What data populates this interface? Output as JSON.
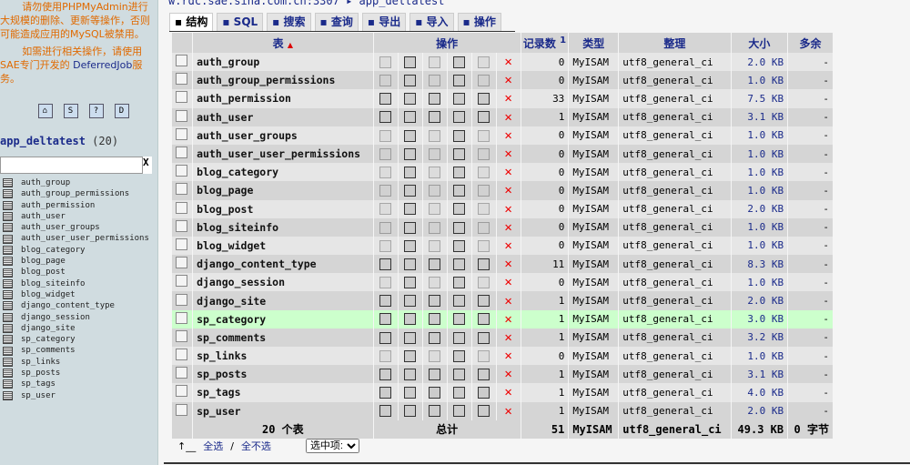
{
  "sidebar": {
    "warning1": "请勿使用PHPMyAdmin进行大规模的删除、更新等操作，否则可能造成应用的MySQL被禁用。",
    "warning2_prefix": "如需进行相关操作，请使用SAE专门开发的 ",
    "warning2_link": "DeferredJob",
    "warning2_suffix": "服务。",
    "db_name": "app_deltatest",
    "db_count": "(20)",
    "filter_clear": "X",
    "icons": [
      "home-icon",
      "sql-icon",
      "help-icon",
      "docs-icon"
    ]
  },
  "breadcrumb": {
    "server": "w.rdc.sae.sina.com.cn:3307",
    "sep": "▸",
    "db": "app_deltatest"
  },
  "tabs": [
    {
      "label": "结构",
      "icon": "structure-icon",
      "active": true
    },
    {
      "label": "SQL",
      "icon": "sql-icon"
    },
    {
      "label": "搜索",
      "icon": "search-icon"
    },
    {
      "label": "查询",
      "icon": "query-icon"
    },
    {
      "label": "导出",
      "icon": "export-icon"
    },
    {
      "label": "导入",
      "icon": "import-icon"
    },
    {
      "label": "操作",
      "icon": "operations-icon"
    }
  ],
  "columns": {
    "table": "表",
    "sort": "▲",
    "ops": "操作",
    "records": "记录数",
    "records_note": "1",
    "type": "类型",
    "collation": "整理",
    "size": "大小",
    "overhead": "多余"
  },
  "rows": [
    {
      "name": "auth_group",
      "records": "0",
      "type": "MyISAM",
      "collation": "utf8_general_ci",
      "size": "2.0 KB",
      "overhead": "-"
    },
    {
      "name": "auth_group_permissions",
      "records": "0",
      "type": "MyISAM",
      "collation": "utf8_general_ci",
      "size": "1.0 KB",
      "overhead": "-"
    },
    {
      "name": "auth_permission",
      "records": "33",
      "type": "MyISAM",
      "collation": "utf8_general_ci",
      "size": "7.5 KB",
      "overhead": "-"
    },
    {
      "name": "auth_user",
      "records": "1",
      "type": "MyISAM",
      "collation": "utf8_general_ci",
      "size": "3.1 KB",
      "overhead": "-"
    },
    {
      "name": "auth_user_groups",
      "records": "0",
      "type": "MyISAM",
      "collation": "utf8_general_ci",
      "size": "1.0 KB",
      "overhead": "-"
    },
    {
      "name": "auth_user_user_permissions",
      "records": "0",
      "type": "MyISAM",
      "collation": "utf8_general_ci",
      "size": "1.0 KB",
      "overhead": "-"
    },
    {
      "name": "blog_category",
      "records": "0",
      "type": "MyISAM",
      "collation": "utf8_general_ci",
      "size": "1.0 KB",
      "overhead": "-"
    },
    {
      "name": "blog_page",
      "records": "0",
      "type": "MyISAM",
      "collation": "utf8_general_ci",
      "size": "1.0 KB",
      "overhead": "-"
    },
    {
      "name": "blog_post",
      "records": "0",
      "type": "MyISAM",
      "collation": "utf8_general_ci",
      "size": "2.0 KB",
      "overhead": "-"
    },
    {
      "name": "blog_siteinfo",
      "records": "0",
      "type": "MyISAM",
      "collation": "utf8_general_ci",
      "size": "1.0 KB",
      "overhead": "-"
    },
    {
      "name": "blog_widget",
      "records": "0",
      "type": "MyISAM",
      "collation": "utf8_general_ci",
      "size": "1.0 KB",
      "overhead": "-"
    },
    {
      "name": "django_content_type",
      "records": "11",
      "type": "MyISAM",
      "collation": "utf8_general_ci",
      "size": "8.3 KB",
      "overhead": "-"
    },
    {
      "name": "django_session",
      "records": "0",
      "type": "MyISAM",
      "collation": "utf8_general_ci",
      "size": "1.0 KB",
      "overhead": "-"
    },
    {
      "name": "django_site",
      "records": "1",
      "type": "MyISAM",
      "collation": "utf8_general_ci",
      "size": "2.0 KB",
      "overhead": "-"
    },
    {
      "name": "sp_category",
      "records": "1",
      "type": "MyISAM",
      "collation": "utf8_general_ci",
      "size": "3.0 KB",
      "overhead": "-",
      "highlight": true
    },
    {
      "name": "sp_comments",
      "records": "1",
      "type": "MyISAM",
      "collation": "utf8_general_ci",
      "size": "3.2 KB",
      "overhead": "-"
    },
    {
      "name": "sp_links",
      "records": "0",
      "type": "MyISAM",
      "collation": "utf8_general_ci",
      "size": "1.0 KB",
      "overhead": "-"
    },
    {
      "name": "sp_posts",
      "records": "1",
      "type": "MyISAM",
      "collation": "utf8_general_ci",
      "size": "3.1 KB",
      "overhead": "-"
    },
    {
      "name": "sp_tags",
      "records": "1",
      "type": "MyISAM",
      "collation": "utf8_general_ci",
      "size": "4.0 KB",
      "overhead": "-"
    },
    {
      "name": "sp_user",
      "records": "1",
      "type": "MyISAM",
      "collation": "utf8_general_ci",
      "size": "2.0 KB",
      "overhead": "-"
    }
  ],
  "footer": {
    "count": "20 个表",
    "total": "总计",
    "records": "51",
    "type": "MyISAM",
    "collation": "utf8_general_ci",
    "size": "49.3 KB",
    "overhead": "0 字节"
  },
  "bottom": {
    "arrow": "↑__",
    "select_all": "全选",
    "sep": "/",
    "select_none": "全不选",
    "with_selected": "选中项:"
  },
  "colors": {
    "sidebar_bg": "#d0dce0",
    "row_highlight": "#ccffcc",
    "drop": "#e00000",
    "link": "#1a2a8a"
  }
}
